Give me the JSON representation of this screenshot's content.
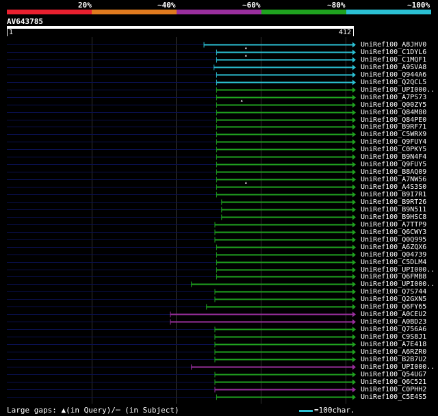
{
  "legend": {
    "segments": [
      {
        "label": "20%",
        "color": "#e8202f"
      },
      {
        "label": "~40%",
        "color": "#e07a1f"
      },
      {
        "label": "~60%",
        "color": "#9a2f9e"
      },
      {
        "label": "~80%",
        "color": "#1fa21f"
      },
      {
        "label": "~100%",
        "color": "#2bc0d3"
      }
    ]
  },
  "query": {
    "name": "AV643785",
    "start": "1",
    "end": "412",
    "length": 412
  },
  "colors": {
    "cyan": "#2bc0d3",
    "green": "#1fa21f",
    "purple": "#9a2f9e",
    "navy": "#0a1050"
  },
  "hits": [
    {
      "label": "UniRef100_A8JHV0",
      "color": "cyan",
      "start": 235
    },
    {
      "label": "UniRef100_C1DYL6",
      "color": "cyan",
      "start": 250,
      "marker": 285
    },
    {
      "label": "UniRef100_C1MQF1",
      "color": "cyan",
      "start": 250,
      "marker": 285
    },
    {
      "label": "UniRef100_A9SVA8",
      "color": "cyan",
      "start": 247
    },
    {
      "label": "UniRef100_Q944A6",
      "color": "cyan",
      "start": 250
    },
    {
      "label": "UniRef100_Q2QCL5",
      "color": "cyan",
      "start": 250
    },
    {
      "label": "UniRef100_UPI000..",
      "color": "green",
      "start": 250
    },
    {
      "label": "UniRef100_A7PS73",
      "color": "green",
      "start": 250
    },
    {
      "label": "UniRef100_Q00ZY5",
      "color": "green",
      "start": 250,
      "marker": 280
    },
    {
      "label": "UniRef100_Q84M80",
      "color": "green",
      "start": 250
    },
    {
      "label": "UniRef100_Q84PE0",
      "color": "green",
      "start": 250
    },
    {
      "label": "UniRef100_B9RF71",
      "color": "green",
      "start": 250
    },
    {
      "label": "UniRef100_C5WRX9",
      "color": "green",
      "start": 250
    },
    {
      "label": "UniRef100_Q9FUY4",
      "color": "green",
      "start": 250
    },
    {
      "label": "UniRef100_C0PKY5",
      "color": "green",
      "start": 250
    },
    {
      "label": "UniRef100_B9N4F4",
      "color": "green",
      "start": 250
    },
    {
      "label": "UniRef100_Q9FUY5",
      "color": "green",
      "start": 250
    },
    {
      "label": "UniRef100_B8AQ09",
      "color": "green",
      "start": 250
    },
    {
      "label": "UniRef100_A7NW56",
      "color": "green",
      "start": 250
    },
    {
      "label": "UniRef100_A4S3S0",
      "color": "green",
      "start": 250,
      "marker": 285
    },
    {
      "label": "UniRef100_B9I7R1",
      "color": "green",
      "start": 250
    },
    {
      "label": "UniRef100_B9RT26",
      "color": "green",
      "start": 256
    },
    {
      "label": "UniRef100_B9N511",
      "color": "green",
      "start": 256
    },
    {
      "label": "UniRef100_B9HSC8",
      "color": "green",
      "start": 256
    },
    {
      "label": "UniRef100_A7TTP9",
      "color": "green",
      "start": 248
    },
    {
      "label": "UniRef100_Q6CWY3",
      "color": "green",
      "start": 248
    },
    {
      "label": "UniRef100_Q0Q995",
      "color": "green",
      "start": 248
    },
    {
      "label": "UniRef100_A6ZQX6",
      "color": "green",
      "start": 250
    },
    {
      "label": "UniRef100_Q04739",
      "color": "green",
      "start": 250
    },
    {
      "label": "UniRef100_C5DLM4",
      "color": "green",
      "start": 250
    },
    {
      "label": "UniRef100_UPI000..",
      "color": "green",
      "start": 250
    },
    {
      "label": "UniRef100_Q6FMB8",
      "color": "green",
      "start": 250
    },
    {
      "label": "UniRef100_UPI000..",
      "color": "green",
      "start": 220
    },
    {
      "label": "UniRef100_Q7S744",
      "color": "green",
      "start": 248
    },
    {
      "label": "UniRef100_Q2GXN5",
      "color": "green",
      "start": 248
    },
    {
      "label": "UniRef100_Q6FY65",
      "color": "green",
      "start": 238
    },
    {
      "label": "UniRef100_A0CEU2",
      "color": "purple",
      "start": 195
    },
    {
      "label": "UniRef100_A0BD23",
      "color": "purple",
      "start": 195
    },
    {
      "label": "UniRef100_Q756A6",
      "color": "green",
      "start": 248
    },
    {
      "label": "UniRef100_C9S8J1",
      "color": "green",
      "start": 248
    },
    {
      "label": "UniRef100_A7E418",
      "color": "green",
      "start": 248
    },
    {
      "label": "UniRef100_A6RZR0",
      "color": "green",
      "start": 248
    },
    {
      "label": "UniRef100_B2B7U2",
      "color": "green",
      "start": 248
    },
    {
      "label": "UniRef100_UPI000..",
      "color": "purple",
      "start": 220
    },
    {
      "label": "UniRef100_Q54UG7",
      "color": "green",
      "start": 248
    },
    {
      "label": "UniRef100_Q6C521",
      "color": "green",
      "start": 248
    },
    {
      "label": "UniRef100_C0PHH2",
      "color": "purple",
      "start": 248
    },
    {
      "label": "UniRef100_C5E4S5",
      "color": "green",
      "start": 250
    }
  ],
  "footer": {
    "gaps_text": "Large gaps: ▲(in Query)/─ (in Subject)",
    "scale_text": "=100char."
  }
}
